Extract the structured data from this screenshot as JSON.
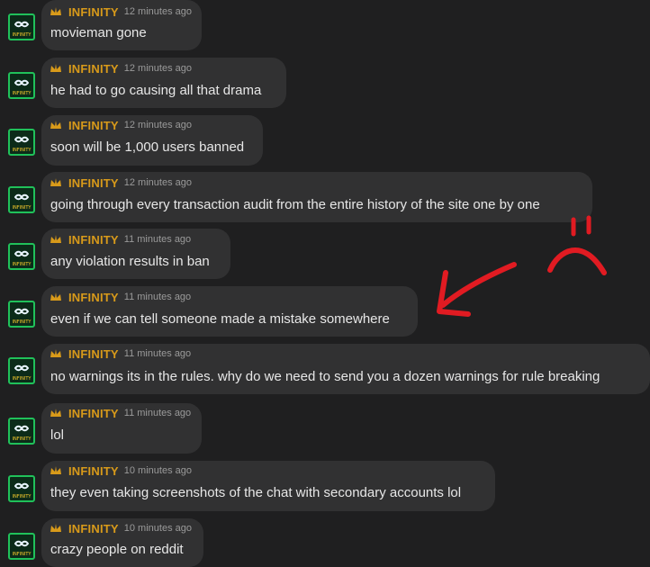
{
  "messages": [
    {
      "user": "INFINITY",
      "time": "12 minutes ago",
      "text": "movieman gone"
    },
    {
      "user": "INFINITY",
      "time": "12 minutes ago",
      "text": "he had to go causing all that drama"
    },
    {
      "user": "INFINITY",
      "time": "12 minutes ago",
      "text": "soon will be 1,000 users banned"
    },
    {
      "user": "INFINITY",
      "time": "12 minutes ago",
      "text": "going through every transaction audit from the entire history of the site one by one"
    },
    {
      "user": "INFINITY",
      "time": "11 minutes ago",
      "text": "any violation results in ban"
    },
    {
      "user": "INFINITY",
      "time": "11 minutes ago",
      "text": "even if we can tell someone made a mistake somewhere"
    },
    {
      "user": "INFINITY",
      "time": "11 minutes ago",
      "text": "no warnings its in the rules. why do we need to send you a dozen warnings for rule breaking"
    },
    {
      "user": "INFINITY",
      "time": "11 minutes ago",
      "text": "lol"
    },
    {
      "user": "INFINITY",
      "time": "10 minutes ago",
      "text": "they even taking screenshots of the chat with secondary accounts lol"
    },
    {
      "user": "INFINITY",
      "time": "10 minutes ago",
      "text": "crazy people on reddit"
    }
  ],
  "avatar_label": "INFINITY",
  "colors": {
    "background": "#1f1f20",
    "bubble": "#313132",
    "username": "#d89a1a",
    "avatar_border": "#20c15a",
    "annotation": "#e11b22"
  },
  "icons": {
    "badge": "crown-icon",
    "annotation_arrow": "arrow-icon",
    "annotation_face": "sad-face-icon"
  }
}
